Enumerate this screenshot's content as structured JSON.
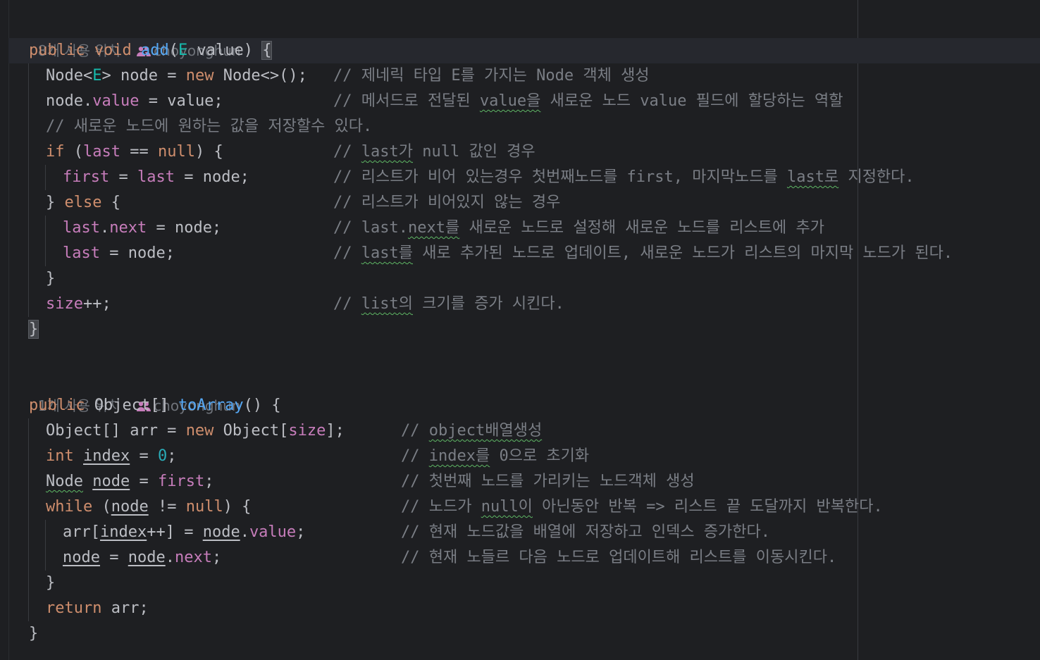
{
  "editor": {
    "methods": [
      {
        "usages_label": "8개 사용 위치",
        "author": "choyonghun",
        "signature": {
          "kw_public": "public",
          "kw_void": "void",
          "name": "add",
          "paren_open": "(",
          "type_param": "E",
          "param": " value",
          "paren_close": ")",
          "brace": "{"
        },
        "lines": {
          "l1_code_a": "Node<",
          "l1_type": "E",
          "l1_code_b": "> node = ",
          "l1_new": "new",
          "l1_code_c": " Node<>();",
          "l1_comment": "// 제네릭 타입 E를 가지는 Node 객체 생성",
          "l2_node": "node.",
          "l2_field": "value",
          "l2_rest": " = value;",
          "l2_comment_a": "// 메서드로 전달된 ",
          "l2_comment_typo": "value을",
          "l2_comment_b": " 새로운 노드 value 필드에 할당하는 역할",
          "l3_comment": "// 새로운 노드에 원하는 값을 저장할수 있다.",
          "l4_if": "if",
          "l4_a": " (",
          "l4_last": "last",
          "l4_eq": " == ",
          "l4_null": "null",
          "l4_b": ") {",
          "l4_comment_a": "// ",
          "l4_comment_typo": "last가",
          "l4_comment_b": " null 값인 경우",
          "l5_first": "first",
          "l5_eq1": " = ",
          "l5_last": "last",
          "l5_rest": " = node;",
          "l5_comment_a": "// 리스트가 비어 있는경우 첫번째노드를 first, 마지막노드를 ",
          "l5_comment_typo": "last로",
          "l5_comment_b": " 지정한다.",
          "l6_close": "} ",
          "l6_else": "else",
          "l6_open": " {",
          "l6_comment": "// 리스트가 비어있지 않는 경우",
          "l7_last": "last",
          "l7_dot": ".",
          "l7_next": "next",
          "l7_rest": " = node;",
          "l7_comment_a": "// last.",
          "l7_comment_typo": "next를",
          "l7_comment_b": " 새로운 노드로 설정해 새로운 노드를 리스트에 추가",
          "l8_last": "last",
          "l8_rest": " = node;",
          "l8_comment_a": "// ",
          "l8_comment_typo": "last를",
          "l8_comment_b": " 새로 추가된 노드로 업데이트, 새로운 노드가 리스트의 마지막 노드가 된다.",
          "l9": "}",
          "l10_size": "size",
          "l10_rest": "++;",
          "l10_comment_a": "// ",
          "l10_comment_typo": "list의",
          "l10_comment_b": " 크기를 증가 시킨다.",
          "l11": "}"
        }
      },
      {
        "usages_label": "1개 사용 위치",
        "author": "choyonghun",
        "signature": {
          "kw_public": "public",
          "type": " Object[] ",
          "name": "toArray",
          "rest": "() {"
        },
        "lines": {
          "l1_a": "Object[] arr = ",
          "l1_new": "new",
          "l1_b": " Object[",
          "l1_size": "size",
          "l1_c": "];",
          "l1_comment_a": "// ",
          "l1_comment_typo": "object배열생성",
          "l2_int": "int",
          "l2_sp": " ",
          "l2_index": "index",
          "l2_eq": " = ",
          "l2_zero": "0",
          "l2_semi": ";",
          "l2_comment_a": "// ",
          "l2_comment_typo": "index를",
          "l2_comment_b": " 0으로 초기화",
          "l3_type": "Node",
          "l3_sp": " ",
          "l3_node": "node",
          "l3_eq": " = ",
          "l3_first": "first",
          "l3_semi": ";",
          "l3_comment": "// 첫번째 노드를 가리키는 노드객체 생성",
          "l4_while": "while",
          "l4_a": " (",
          "l4_node": "node",
          "l4_ne": " != ",
          "l4_null": "null",
          "l4_b": ") {",
          "l4_comment_a": "// 노드가 ",
          "l4_comment_typo": "null이",
          "l4_comment_b": " 아닌동안 반복 => 리스트 끝 도달까지 반복한다.",
          "l5_a": "arr[",
          "l5_index": "index",
          "l5_b": "++] = ",
          "l5_node": "node",
          "l5_dot": ".",
          "l5_value": "value",
          "l5_semi": ";",
          "l5_comment": "// 현재 노드값을 배열에 저장하고 인덱스 증가한다.",
          "l6_node": "node",
          "l6_eq": " = ",
          "l6_node2": "node",
          "l6_dot": ".",
          "l6_next": "next",
          "l6_semi": ";",
          "l6_comment": "// 현재 노들르 다음 노드로 업데이트해 리스트를 이동시킨다.",
          "l7": "}",
          "l8_return": "return",
          "l8_rest": " arr;",
          "l9": "}"
        }
      }
    ]
  },
  "colors": {
    "background": "#1e1f22",
    "keyword": "#cf8e6d",
    "function": "#56a8f5",
    "field": "#c77dbb",
    "number": "#2aacb8",
    "comment": "#7a7e85",
    "text": "#bcbec4",
    "typo_underline": "#5fb865"
  },
  "icons": {
    "author_icon": "people-icon"
  }
}
